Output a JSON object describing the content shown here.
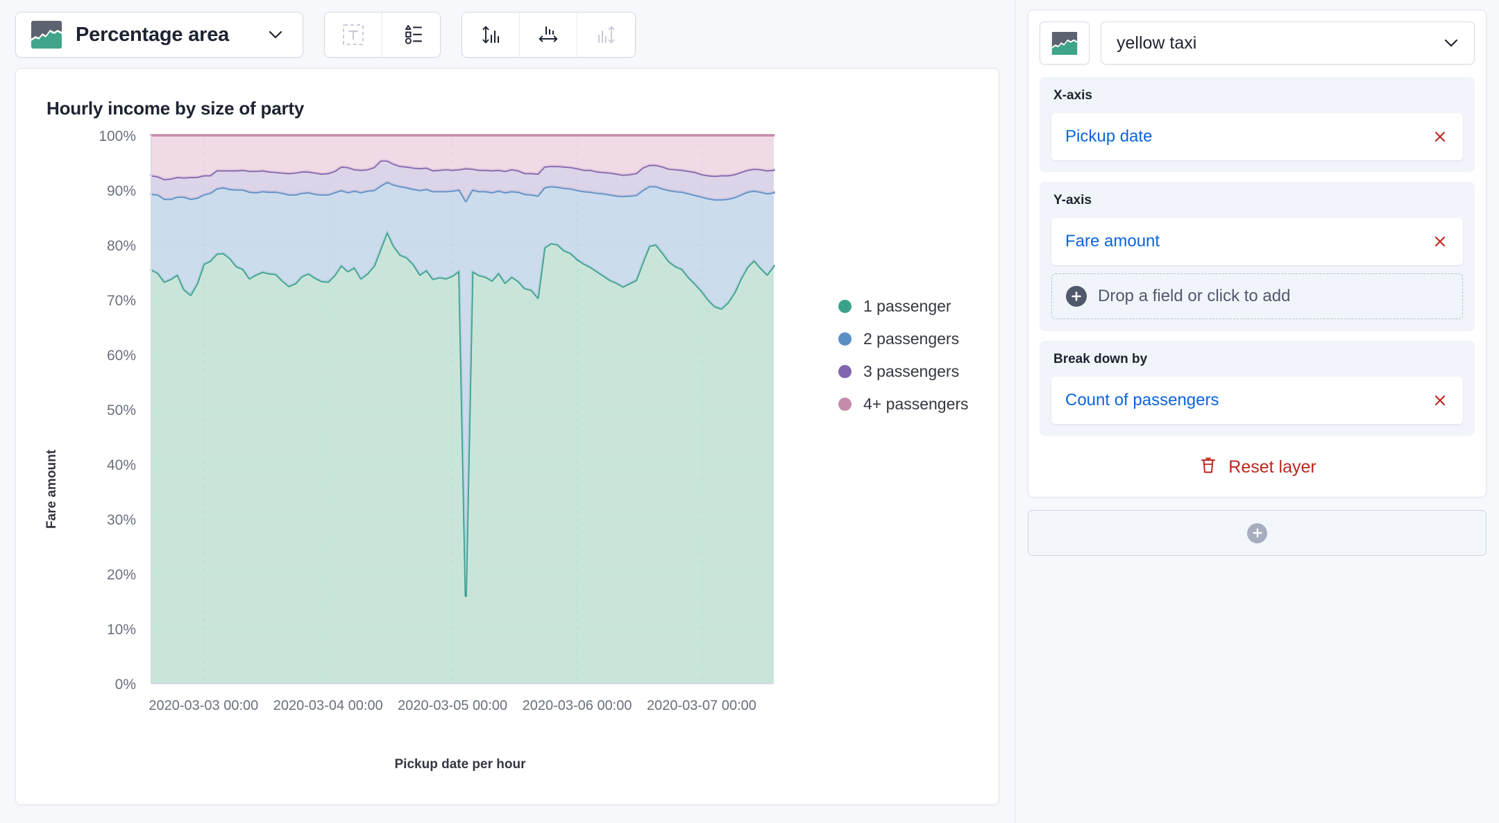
{
  "toolbar": {
    "chart_type_label": "Percentage area",
    "chart_type_icon": "percentage-area-icon",
    "chevron_icon": "chevron-down-icon",
    "buttons": [
      {
        "name": "text-annotation-button",
        "icon": "text-in-dashed-box-icon",
        "state": "disabled"
      },
      {
        "name": "legend-settings-button",
        "icon": "legend-list-icon",
        "state": "enabled"
      },
      {
        "name": "left-axis-button",
        "icon": "vertical-axis-icon",
        "state": "enabled"
      },
      {
        "name": "bottom-axis-button",
        "icon": "horizontal-axis-icon",
        "state": "enabled"
      },
      {
        "name": "right-axis-button",
        "icon": "right-axis-icon",
        "state": "disabled"
      }
    ]
  },
  "chart_data": {
    "type": "area",
    "stacked": "percentage",
    "title": "Hourly income by size of party",
    "xlabel": "Pickup date per hour",
    "ylabel": "Fare amount",
    "ylim": [
      0,
      100
    ],
    "yticks": [
      "0%",
      "10%",
      "20%",
      "30%",
      "40%",
      "50%",
      "60%",
      "70%",
      "80%",
      "90%",
      "100%"
    ],
    "ytick_values": [
      0,
      10,
      20,
      30,
      40,
      50,
      60,
      70,
      80,
      90,
      100
    ],
    "xticks": [
      "2020-03-03 00:00",
      "2020-03-04 00:00",
      "2020-03-05 00:00",
      "2020-03-06 00:00",
      "2020-03-07 00:00"
    ],
    "grid": true,
    "legend_position": "right",
    "legend": [
      "1 passenger",
      "2 passengers",
      "3 passengers",
      "4+ passengers"
    ],
    "colors": [
      "#3BA18A",
      "#5B8FC4",
      "#8166AE",
      "#C48BAB"
    ],
    "fill_colors": [
      "#BFE0D4",
      "#C3D6EA",
      "#D6CCE4",
      "#EDD3E0"
    ],
    "series": [
      {
        "name": "1 passenger",
        "values": [
          75.5,
          74.9,
          73.3,
          73.8,
          74.6,
          71.9,
          70.9,
          73.0,
          76.5,
          77.1,
          78.4,
          78.5,
          77.6,
          76.1,
          75.6,
          73.9,
          74.6,
          75.1,
          74.8,
          74.7,
          73.5,
          72.5,
          73.0,
          74.3,
          74.8,
          74.0,
          73.4,
          73.3,
          74.5,
          76.3,
          75.2,
          75.9,
          73.9,
          74.8,
          76.2,
          79.3,
          82.4,
          79.8,
          78.2,
          77.7,
          76.5,
          74.6,
          75.4,
          73.8,
          74.1,
          73.9,
          74.4,
          75.3,
          16.0,
          75.2,
          74.5,
          74.2,
          73.5,
          74.9,
          73.1,
          74.2,
          73.4,
          72.1,
          71.8,
          70.4,
          79.5,
          80.3,
          80.1,
          79.0,
          78.5,
          77.4,
          76.6,
          76.0,
          75.2,
          74.4,
          73.6,
          73.1,
          72.4,
          73.0,
          73.6,
          76.8,
          79.8,
          80.1,
          78.6,
          77.0,
          76.1,
          75.6,
          74.1,
          72.9,
          71.6,
          70.0,
          68.8,
          68.4,
          69.5,
          71.3,
          73.9,
          76.0,
          77.2,
          75.8,
          74.6,
          76.2
        ]
      },
      {
        "name": "2 passengers",
        "values": [
          13.8,
          14.3,
          15.1,
          14.6,
          14.2,
          16.9,
          17.5,
          15.6,
          12.7,
          12.4,
          11.9,
          12.0,
          12.6,
          14.0,
          14.5,
          15.8,
          15.0,
          14.7,
          14.9,
          15.0,
          16.0,
          16.7,
          16.2,
          15.2,
          14.8,
          15.3,
          15.8,
          15.9,
          15.1,
          13.7,
          14.4,
          14.0,
          15.7,
          15.1,
          13.8,
          11.5,
          9.1,
          11.2,
          12.5,
          12.8,
          13.7,
          15.4,
          14.8,
          16.0,
          15.7,
          15.9,
          15.5,
          14.8,
          72.0,
          14.9,
          15.3,
          15.6,
          16.1,
          15.0,
          16.5,
          15.6,
          16.3,
          17.2,
          17.4,
          18.6,
          11.0,
          10.4,
          10.5,
          11.4,
          11.8,
          12.6,
          13.2,
          13.7,
          14.3,
          15.0,
          15.6,
          15.9,
          16.5,
          16.0,
          15.5,
          13.2,
          10.9,
          10.6,
          11.7,
          13.0,
          13.7,
          14.1,
          15.3,
          16.2,
          17.2,
          18.5,
          19.5,
          19.9,
          18.9,
          17.4,
          15.3,
          13.7,
          12.7,
          13.9,
          14.8,
          13.4
        ]
      },
      {
        "name": "3 passengers",
        "values": [
          3.4,
          3.3,
          3.6,
          3.7,
          3.6,
          3.5,
          4.0,
          3.8,
          3.5,
          3.2,
          3.3,
          3.1,
          3.4,
          3.5,
          3.6,
          3.8,
          3.9,
          3.8,
          3.7,
          3.6,
          3.7,
          3.9,
          4.0,
          3.9,
          3.8,
          3.9,
          3.8,
          3.9,
          3.9,
          4.3,
          4.6,
          3.9,
          4.1,
          3.9,
          4.2,
          4.6,
          3.9,
          3.8,
          3.7,
          3.8,
          3.9,
          4.0,
          3.9,
          3.8,
          3.9,
          4.0,
          3.8,
          3.7,
          6.0,
          3.8,
          3.9,
          3.9,
          4.0,
          3.8,
          3.9,
          4.0,
          3.9,
          3.8,
          3.9,
          4.0,
          3.8,
          3.7,
          3.8,
          3.9,
          3.9,
          4.0,
          3.9,
          4.0,
          3.9,
          3.9,
          4.0,
          4.0,
          3.9,
          3.9,
          4.0,
          4.1,
          3.9,
          3.9,
          4.0,
          3.9,
          4.0,
          4.0,
          4.1,
          4.2,
          4.1,
          4.2,
          4.3,
          4.4,
          4.3,
          4.2,
          4.1,
          4.0,
          4.0,
          4.1,
          4.2,
          4.1
        ]
      },
      {
        "name": "4+ passengers",
        "values": [
          7.3,
          7.5,
          8.0,
          7.9,
          7.6,
          7.7,
          7.6,
          7.6,
          7.3,
          7.3,
          6.4,
          6.4,
          6.4,
          6.4,
          6.3,
          6.5,
          6.5,
          6.4,
          6.6,
          6.7,
          6.8,
          6.9,
          6.8,
          6.6,
          6.6,
          6.8,
          7.0,
          6.9,
          6.5,
          5.7,
          5.8,
          6.2,
          6.3,
          6.2,
          5.8,
          4.6,
          4.6,
          5.2,
          5.6,
          5.7,
          5.9,
          6.0,
          5.9,
          6.4,
          6.3,
          6.2,
          6.3,
          6.2,
          6.0,
          6.1,
          6.3,
          6.3,
          6.4,
          6.3,
          6.5,
          6.2,
          6.4,
          6.9,
          6.9,
          7.0,
          5.7,
          5.6,
          5.6,
          5.7,
          5.8,
          6.0,
          6.3,
          6.3,
          6.6,
          6.7,
          6.8,
          7.0,
          7.2,
          7.1,
          6.9,
          5.9,
          5.4,
          5.4,
          5.7,
          6.1,
          6.2,
          6.3,
          6.5,
          6.7,
          7.1,
          7.3,
          7.4,
          7.3,
          7.3,
          7.1,
          6.7,
          6.3,
          6.1,
          6.2,
          6.4,
          6.3
        ]
      }
    ]
  },
  "config_panel": {
    "layer_chart_icon": "percentage-area-icon",
    "datasource_name": "yellow taxi",
    "datasource_chevron": "chevron-down-icon",
    "groups": [
      {
        "label": "X-axis",
        "name": "x-axis",
        "fields": [
          {
            "label": "Pickup date",
            "remove_icon": "close-x-icon"
          }
        ],
        "dropzone": null
      },
      {
        "label": "Y-axis",
        "name": "y-axis",
        "fields": [
          {
            "label": "Fare amount",
            "remove_icon": "close-x-icon"
          }
        ],
        "dropzone": {
          "text": "Drop a field or click to add",
          "icon": "plus-circle-icon"
        }
      },
      {
        "label": "Break down by",
        "name": "break-down-by",
        "fields": [
          {
            "label": "Count of passengers",
            "remove_icon": "close-x-icon"
          }
        ],
        "dropzone": null
      }
    ],
    "reset_layer_label": "Reset layer",
    "reset_layer_icon": "trash-icon",
    "add_layer_icon": "plus-circle-icon"
  },
  "colors": {
    "accent_link": "#0B64DD",
    "danger": "#BD271E",
    "page_bg": "#F7F8FC",
    "panel_bg": "#FFFFFF",
    "group_bg": "#F1F4FA"
  }
}
